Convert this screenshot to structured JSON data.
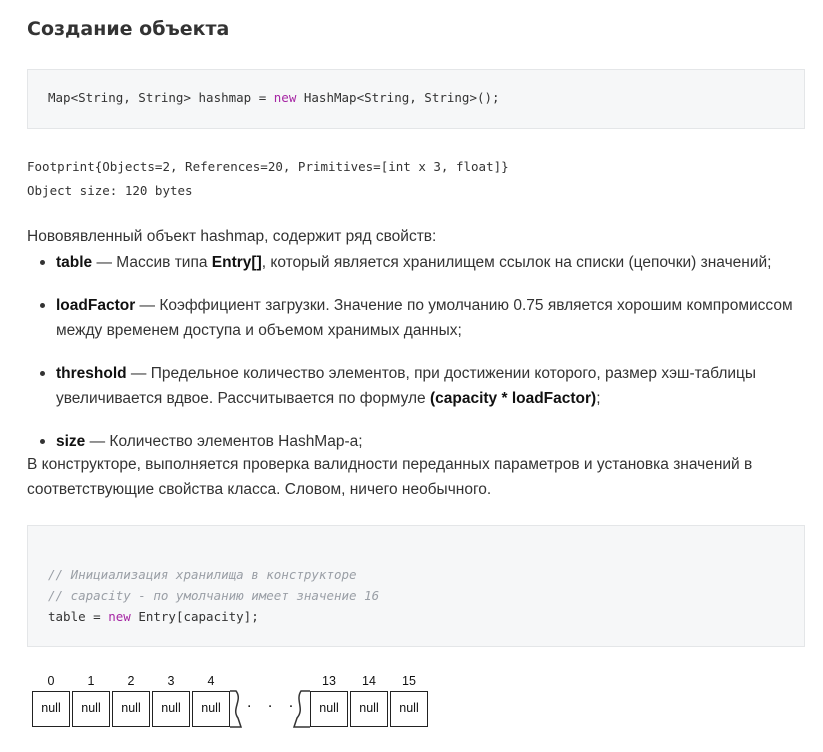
{
  "heading": "Создание объекта",
  "code1": {
    "pre": "Map<String, String> hashmap = ",
    "kw": "new",
    "post": " HashMap<String, String>();"
  },
  "footprint": {
    "line1": "Footprint{Objects=2, References=20, Primitives=[int x 3, float]}",
    "line2": "Object size: 120 bytes"
  },
  "intro": "Нововявленный объект hashmap, содержит ряд свойств:",
  "properties": [
    {
      "name": "table",
      "parts": [
        " — Массив типа ",
        "Entry[]",
        ", который является хранилищем ссылок на списки (цепочки) значений;"
      ]
    },
    {
      "name": "loadFactor",
      "desc": " — Коэффициент загрузки. Значение по умолчанию 0.75 является хорошим компромиссом между временем доступа и объемом хранимых данных;"
    },
    {
      "name": "threshold",
      "desc": " — Предельное количество элементов, при достижении которого, размер хэш-таблицы увеличивается вдвое. Рассчитывается по формуле ",
      "formula": "(capacity * loadFactor)",
      "tail": ";"
    },
    {
      "name": "size",
      "desc": " — Количество элементов HashMap-а;"
    }
  ],
  "constructor_text": "В конструкторе, выполняется проверка валидности переданных параметров и установка значений в соответствующие свойства класса. Словом, ничего необычного.",
  "code2": {
    "comment1": "// Инициализация хранилища в конструкторе",
    "comment2": "// capacity - по умолчанию имеет значение 16",
    "pre": "table = ",
    "kw": "new",
    "post": " Entry[capacity];"
  },
  "array": {
    "left_indices": [
      "0",
      "1",
      "2",
      "3",
      "4"
    ],
    "right_indices": [
      "13",
      "14",
      "15"
    ],
    "cell_value": "null",
    "ellipsis": ". . ."
  }
}
